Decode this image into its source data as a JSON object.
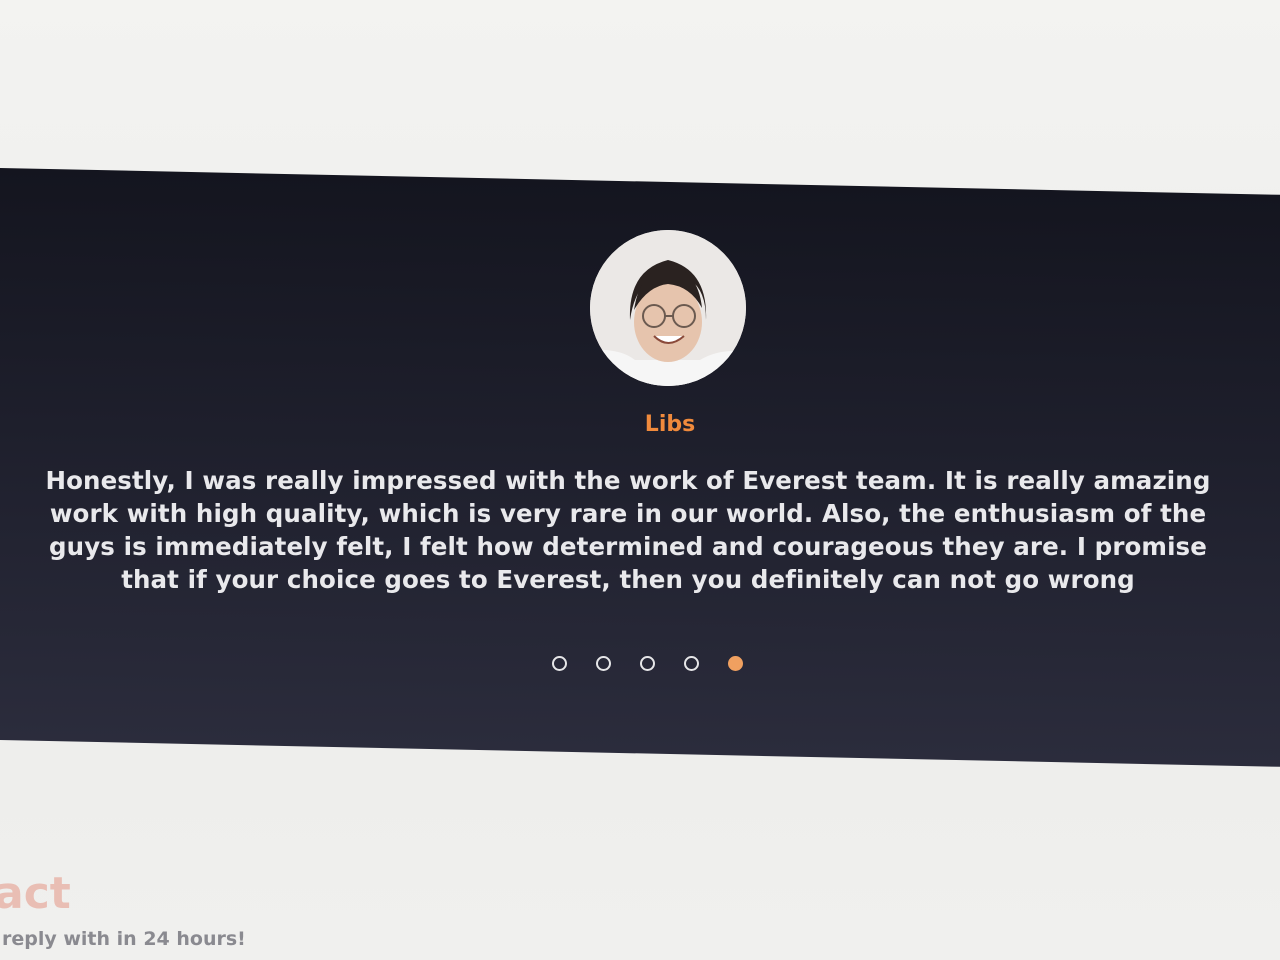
{
  "testimonial": {
    "name": "Libs",
    "quote": "Honestly, I was really impressed with the work of Everest team. It is really amazing work with high quality, which is very rare in our world. Also, the enthusiasm of the guys is immediately felt, I felt how determined and courageous they are. I promise that if your choice goes to Everest, then you definitely can not go wrong"
  },
  "carousel": {
    "total_slides": 5,
    "active_slide": 5
  },
  "contact": {
    "title": "act",
    "subtitle": "reply with in 24 hours!"
  },
  "colors": {
    "accent": "#f08a3c",
    "band_background": "#1e1f2c",
    "text": "#e9e9ec"
  }
}
